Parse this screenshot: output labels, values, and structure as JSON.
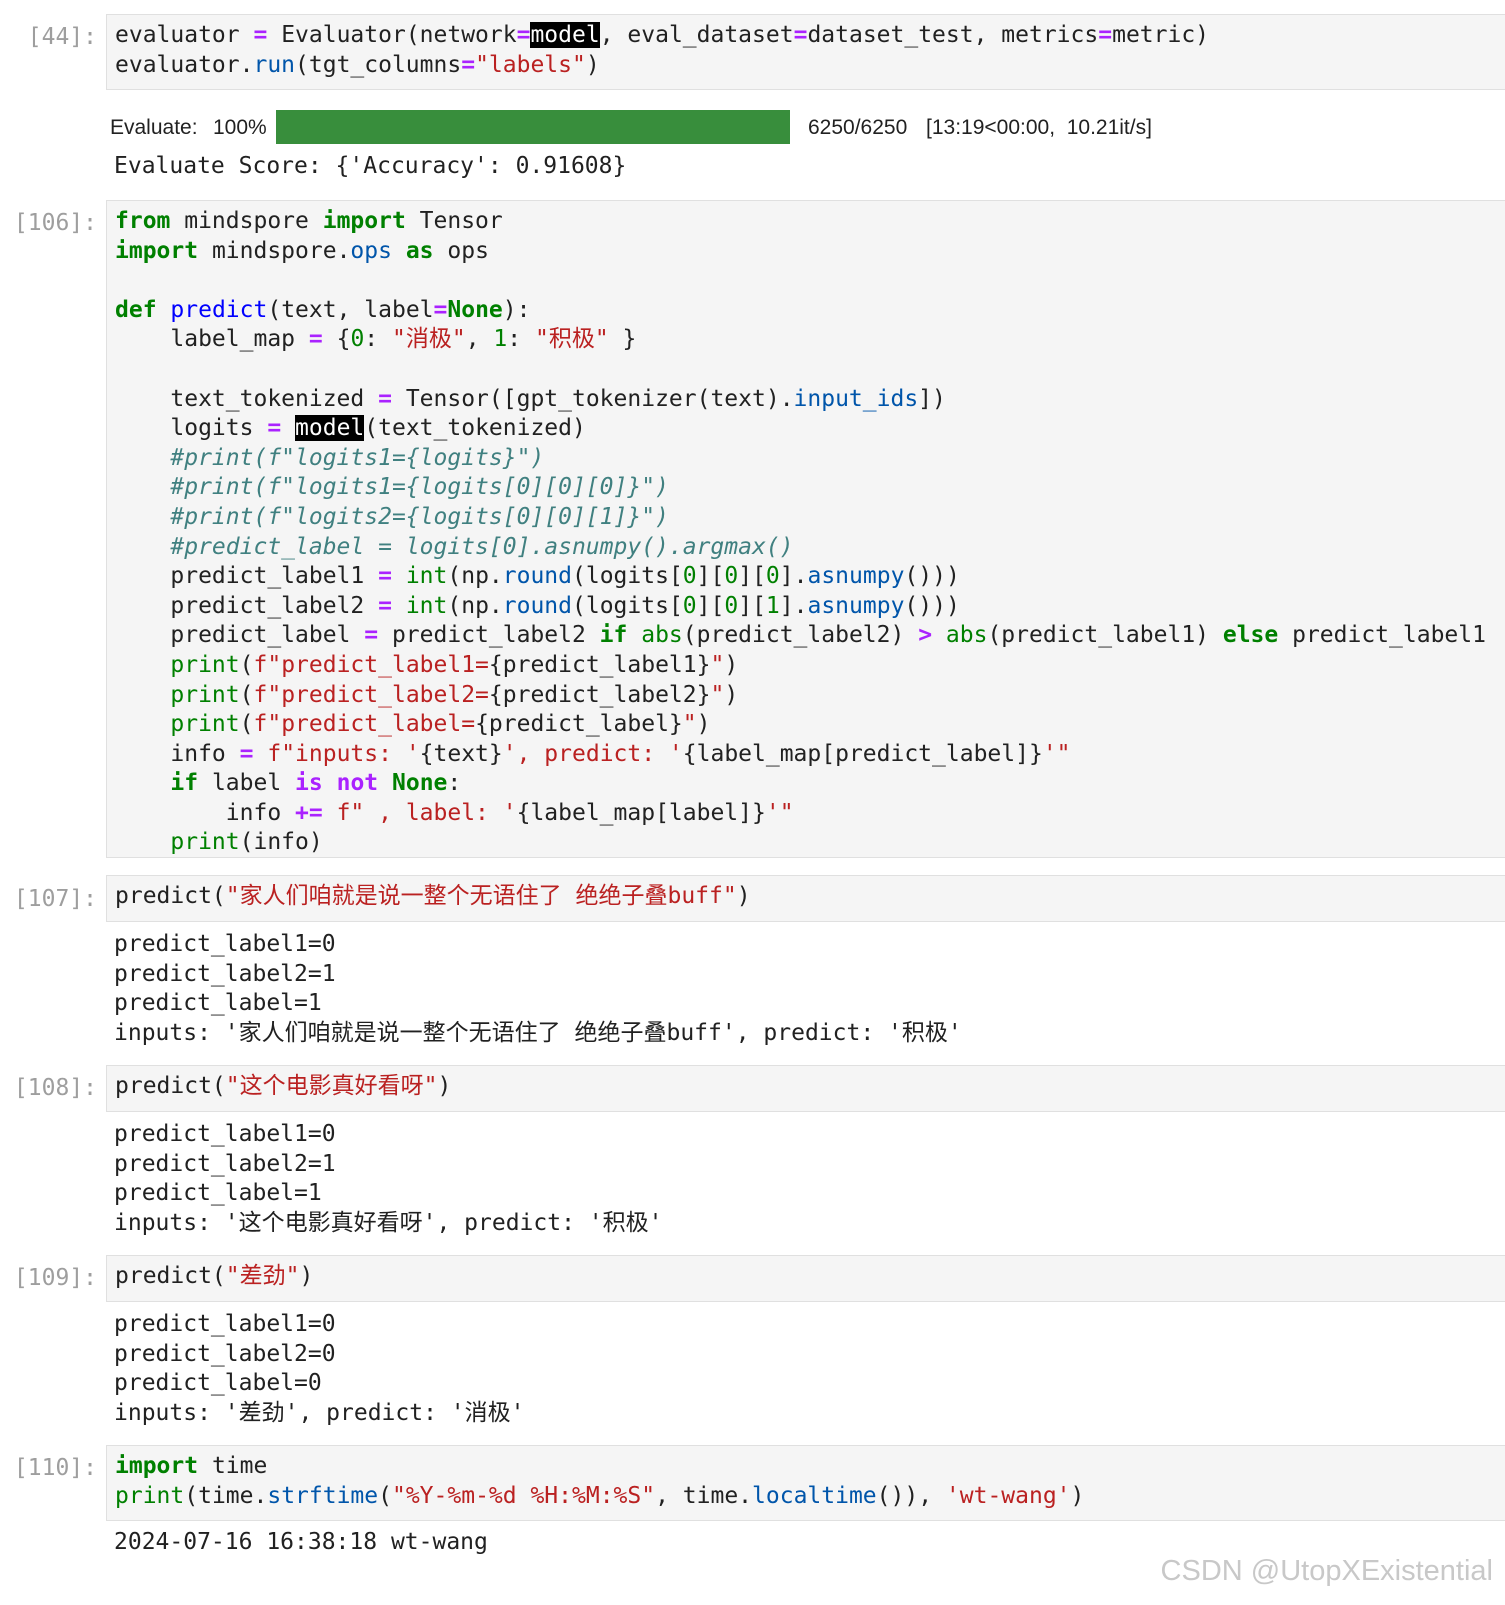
{
  "cells": [
    {
      "prompt": "[44]:",
      "code_lines": [
        [
          [
            "evaluator ",
            ""
          ],
          [
            "=",
            "op"
          ],
          [
            " Evaluator(network",
            ""
          ],
          [
            "=",
            "op"
          ],
          [
            "model",
            "hl"
          ],
          [
            ", eval_dataset",
            ""
          ],
          [
            "=",
            "op"
          ],
          [
            "dataset_test, metrics",
            ""
          ],
          [
            "=",
            "op"
          ],
          [
            "metric)",
            ""
          ]
        ],
        [
          [
            "evaluator.",
            ""
          ],
          [
            "run",
            "attr"
          ],
          [
            "(tgt_columns",
            ""
          ],
          [
            "=",
            "op"
          ],
          [
            "\"labels\"",
            "str"
          ],
          [
            ")",
            ""
          ]
        ]
      ],
      "progress": {
        "label": "Evaluate:",
        "percent_text": "100%",
        "fraction": 1.0,
        "count_text": "6250/6250",
        "timing_text": "[13:19<00:00,  10.21it/s]"
      },
      "output_lines": [
        "Evaluate Score: {'Accuracy': 0.91608}"
      ]
    },
    {
      "prompt": "[106]:",
      "code_lines": [
        [
          [
            "from",
            "kw"
          ],
          [
            " mindspore ",
            ""
          ],
          [
            "import",
            "kw"
          ],
          [
            " Tensor",
            ""
          ]
        ],
        [
          [
            "import",
            "kw"
          ],
          [
            " mindspore.",
            ""
          ],
          [
            "ops",
            "attr"
          ],
          [
            " ",
            ""
          ],
          [
            "as",
            "kw"
          ],
          [
            " ops",
            ""
          ]
        ],
        [],
        [
          [
            "def",
            "kw"
          ],
          [
            " ",
            ""
          ],
          [
            "predict",
            "fn"
          ],
          [
            "(text, label",
            ""
          ],
          [
            "=",
            "op"
          ],
          [
            "None",
            "kw"
          ],
          [
            "):",
            ""
          ]
        ],
        [
          [
            "    label_map ",
            ""
          ],
          [
            "=",
            "op"
          ],
          [
            " {",
            ""
          ],
          [
            "0",
            "num"
          ],
          [
            ": ",
            ""
          ],
          [
            "\"消极\"",
            "str"
          ],
          [
            ", ",
            ""
          ],
          [
            "1",
            "num"
          ],
          [
            ": ",
            ""
          ],
          [
            "\"积极\"",
            "str"
          ],
          [
            " }",
            ""
          ]
        ],
        [],
        [
          [
            "    text_tokenized ",
            ""
          ],
          [
            "=",
            "op"
          ],
          [
            " Tensor([gpt_tokenizer(text).",
            ""
          ],
          [
            "input_ids",
            "attr"
          ],
          [
            "])",
            ""
          ]
        ],
        [
          [
            "    logits ",
            ""
          ],
          [
            "=",
            "op"
          ],
          [
            " ",
            ""
          ],
          [
            "model",
            "hl"
          ],
          [
            "(text_tokenized)",
            ""
          ]
        ],
        [
          [
            "    ",
            ""
          ],
          [
            "#print(f\"logits1={logits}\")",
            "cm"
          ]
        ],
        [
          [
            "    ",
            ""
          ],
          [
            "#print(f\"logits1={logits[0][0][0]}\")",
            "cm"
          ]
        ],
        [
          [
            "    ",
            ""
          ],
          [
            "#print(f\"logits2={logits[0][0][1]}\")",
            "cm"
          ]
        ],
        [
          [
            "    ",
            ""
          ],
          [
            "#predict_label = logits[0].asnumpy().argmax()",
            "cm"
          ]
        ],
        [
          [
            "    predict_label1 ",
            ""
          ],
          [
            "=",
            "op"
          ],
          [
            " ",
            ""
          ],
          [
            "int",
            "bi"
          ],
          [
            "(np.",
            ""
          ],
          [
            "round",
            "attr"
          ],
          [
            "(logits[",
            ""
          ],
          [
            "0",
            "num"
          ],
          [
            "][",
            ""
          ],
          [
            "0",
            "num"
          ],
          [
            "][",
            ""
          ],
          [
            "0",
            "num"
          ],
          [
            "].",
            ""
          ],
          [
            "asnumpy",
            "attr"
          ],
          [
            "()))",
            ""
          ]
        ],
        [
          [
            "    predict_label2 ",
            ""
          ],
          [
            "=",
            "op"
          ],
          [
            " ",
            ""
          ],
          [
            "int",
            "bi"
          ],
          [
            "(np.",
            ""
          ],
          [
            "round",
            "attr"
          ],
          [
            "(logits[",
            ""
          ],
          [
            "0",
            "num"
          ],
          [
            "][",
            ""
          ],
          [
            "0",
            "num"
          ],
          [
            "][",
            ""
          ],
          [
            "1",
            "num"
          ],
          [
            "].",
            ""
          ],
          [
            "asnumpy",
            "attr"
          ],
          [
            "()))",
            ""
          ]
        ],
        [
          [
            "    predict_label ",
            ""
          ],
          [
            "=",
            "op"
          ],
          [
            " predict_label2 ",
            ""
          ],
          [
            "if",
            "kw"
          ],
          [
            " ",
            ""
          ],
          [
            "abs",
            "bi"
          ],
          [
            "(predict_label2) ",
            ""
          ],
          [
            ">",
            "op"
          ],
          [
            " ",
            ""
          ],
          [
            "abs",
            "bi"
          ],
          [
            "(predict_label1) ",
            ""
          ],
          [
            "else",
            "kw"
          ],
          [
            " predict_label1",
            ""
          ]
        ],
        [
          [
            "    ",
            ""
          ],
          [
            "print",
            "bi"
          ],
          [
            "(",
            ""
          ],
          [
            "f\"predict_label1=",
            "str"
          ],
          [
            "{predict_label1}",
            ""
          ],
          [
            "\"",
            "str"
          ],
          [
            ")",
            ""
          ]
        ],
        [
          [
            "    ",
            ""
          ],
          [
            "print",
            "bi"
          ],
          [
            "(",
            ""
          ],
          [
            "f\"predict_label2=",
            "str"
          ],
          [
            "{predict_label2}",
            ""
          ],
          [
            "\"",
            "str"
          ],
          [
            ")",
            ""
          ]
        ],
        [
          [
            "    ",
            ""
          ],
          [
            "print",
            "bi"
          ],
          [
            "(",
            ""
          ],
          [
            "f\"predict_label=",
            "str"
          ],
          [
            "{predict_label}",
            ""
          ],
          [
            "\"",
            "str"
          ],
          [
            ")",
            ""
          ]
        ],
        [
          [
            "    info ",
            ""
          ],
          [
            "=",
            "op"
          ],
          [
            " ",
            ""
          ],
          [
            "f\"inputs: '",
            "str"
          ],
          [
            "{text}",
            ""
          ],
          [
            "', predict: '",
            "str"
          ],
          [
            "{label_map[predict_label]}",
            ""
          ],
          [
            "'\"",
            "str"
          ]
        ],
        [
          [
            "    ",
            ""
          ],
          [
            "if",
            "kw"
          ],
          [
            " label ",
            ""
          ],
          [
            "is",
            "op"
          ],
          [
            " ",
            ""
          ],
          [
            "not",
            "op"
          ],
          [
            " ",
            ""
          ],
          [
            "None",
            "kw"
          ],
          [
            ":",
            ""
          ]
        ],
        [
          [
            "        info ",
            ""
          ],
          [
            "+=",
            "op"
          ],
          [
            " ",
            ""
          ],
          [
            "f\" , label: '",
            "str"
          ],
          [
            "{label_map[label]}",
            ""
          ],
          [
            "'\"",
            "str"
          ]
        ],
        [
          [
            "    ",
            ""
          ],
          [
            "print",
            "bi"
          ],
          [
            "(info)",
            ""
          ]
        ]
      ],
      "output_lines": []
    },
    {
      "prompt": "[107]:",
      "code_lines": [
        [
          [
            "predict(",
            ""
          ],
          [
            "\"家人们咱就是说一整个无语住了 绝绝子叠buff\"",
            "str"
          ],
          [
            ")",
            ""
          ]
        ]
      ],
      "output_lines": [
        "predict_label1=0",
        "predict_label2=1",
        "predict_label=1",
        "inputs: '家人们咱就是说一整个无语住了 绝绝子叠buff', predict: '积极'"
      ]
    },
    {
      "prompt": "[108]:",
      "code_lines": [
        [
          [
            "predict(",
            ""
          ],
          [
            "\"这个电影真好看呀\"",
            "str"
          ],
          [
            ")",
            ""
          ]
        ]
      ],
      "output_lines": [
        "predict_label1=0",
        "predict_label2=1",
        "predict_label=1",
        "inputs: '这个电影真好看呀', predict: '积极'"
      ]
    },
    {
      "prompt": "[109]:",
      "code_lines": [
        [
          [
            "predict(",
            ""
          ],
          [
            "\"差劲\"",
            "str"
          ],
          [
            ")",
            ""
          ]
        ]
      ],
      "output_lines": [
        "predict_label1=0",
        "predict_label2=0",
        "predict_label=0",
        "inputs: '差劲', predict: '消极'"
      ]
    },
    {
      "prompt": "[110]:",
      "code_lines": [
        [
          [
            "import",
            "kw"
          ],
          [
            " time",
            ""
          ]
        ],
        [
          [
            "print",
            "bi"
          ],
          [
            "(time.",
            ""
          ],
          [
            "strftime",
            "attr"
          ],
          [
            "(",
            ""
          ],
          [
            "\"%Y-%m-%d %H:%M:%S\"",
            "str"
          ],
          [
            ", time.",
            ""
          ],
          [
            "localtime",
            "attr"
          ],
          [
            "()), ",
            ""
          ],
          [
            "'wt-wang'",
            "str"
          ],
          [
            ")",
            ""
          ]
        ]
      ],
      "output_lines": [
        "2024-07-16 16:38:18 wt-wang"
      ]
    }
  ],
  "watermark": "CSDN @UtopXExistential"
}
